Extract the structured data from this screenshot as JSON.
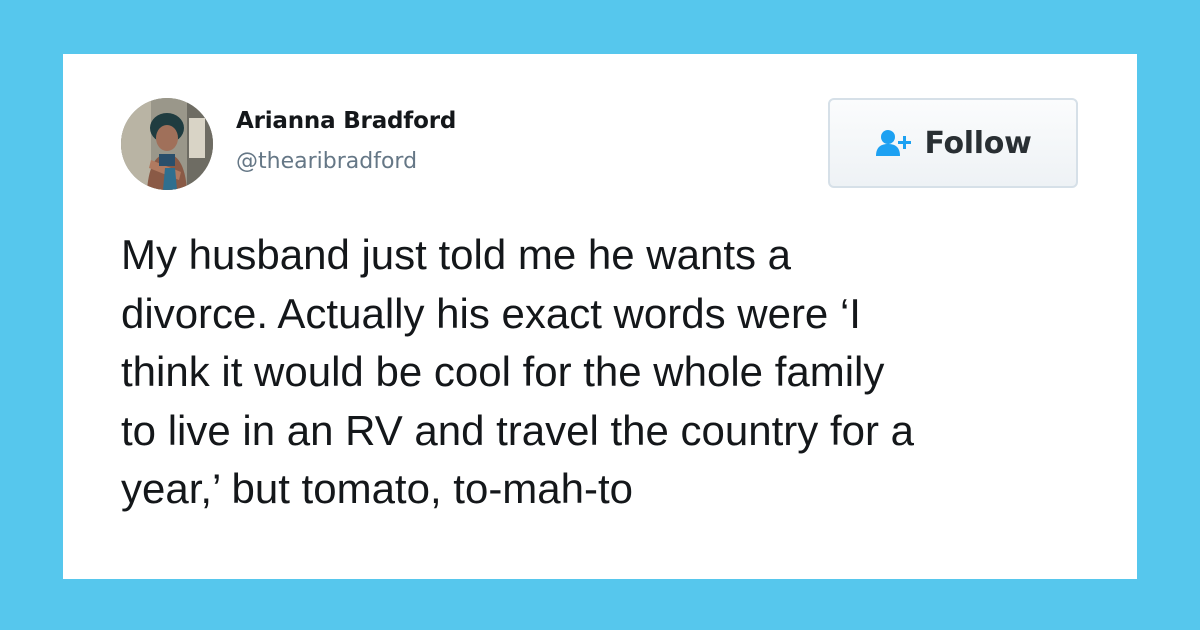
{
  "tweet": {
    "author": {
      "display_name": "Arianna Bradford",
      "handle": "@thearibradford"
    },
    "follow_button": {
      "label": "Follow",
      "icon": "add-user-icon"
    },
    "text": "My husband just told me he wants a\ndivorce. Actually his exact words were ‘I\nthink it would be cool for the whole family\nto live in an RV and travel the country for a\nyear,’ but tomato, to-mah-to"
  },
  "colors": {
    "background": "#56c7ed",
    "card": "#ffffff",
    "name_text": "#14171a",
    "handle_text": "#657786",
    "follow_icon": "#1da1f2",
    "follow_text": "#292f33",
    "follow_border": "#d6e0e8"
  }
}
